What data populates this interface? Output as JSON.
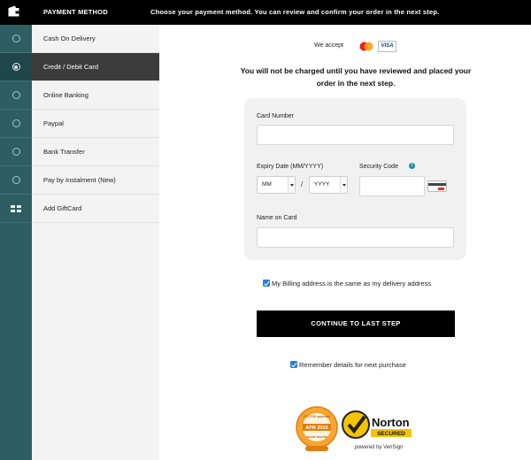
{
  "header": {
    "section_title": "PAYMENT METHOD",
    "hint": "Choose your payment method. You can review and confirm your order in the next step."
  },
  "methods": [
    {
      "label": "Cash On Delivery",
      "selected": false,
      "icon": "radio-icon"
    },
    {
      "label": "Credit / Debit Card",
      "selected": true,
      "icon": "radio-icon"
    },
    {
      "label": "Online Banking",
      "selected": false,
      "icon": "radio-icon"
    },
    {
      "label": "Paypal",
      "selected": false,
      "icon": "radio-icon"
    },
    {
      "label": "Bank Transfer",
      "selected": false,
      "icon": "radio-icon"
    },
    {
      "label": "Pay by Instalment (New)",
      "selected": false,
      "icon": "radio-icon"
    },
    {
      "label": "Add GiftCard",
      "selected": false,
      "icon": "gift-card-icon"
    }
  ],
  "main": {
    "we_accept": "We accept",
    "visa": "VISA",
    "notice": "You will not be charged until you have reviewed and placed your order in the next step.",
    "form": {
      "card_number_label": "Card Number",
      "card_number_value": "",
      "expiry_label": "Expiry Date (MM/YYYY)",
      "month_value": "MM",
      "separator": "/",
      "year_value": "YYYY",
      "security_label": "Security Code",
      "security_value": "",
      "name_label": "Name on Card",
      "name_value": ""
    },
    "billing_same": {
      "label": "My Billing address is the same as my delivery address",
      "checked": true
    },
    "continue_label": "CONTINUE TO LAST STEP",
    "remember": {
      "label": "Remember details for next purchase",
      "checked": true
    },
    "badges": {
      "pci_lines": [
        "PCI DSS approved",
        "APR 2016",
        "secure security"
      ],
      "norton_brand": "Norton",
      "norton_secured": "SECURED",
      "norton_powered": "powered by VeriSign"
    }
  },
  "colors": {
    "rail": "#2e5e62",
    "active_method": "#3c3c3c",
    "checkbox": "#2c7fd6",
    "button": "#000000"
  }
}
